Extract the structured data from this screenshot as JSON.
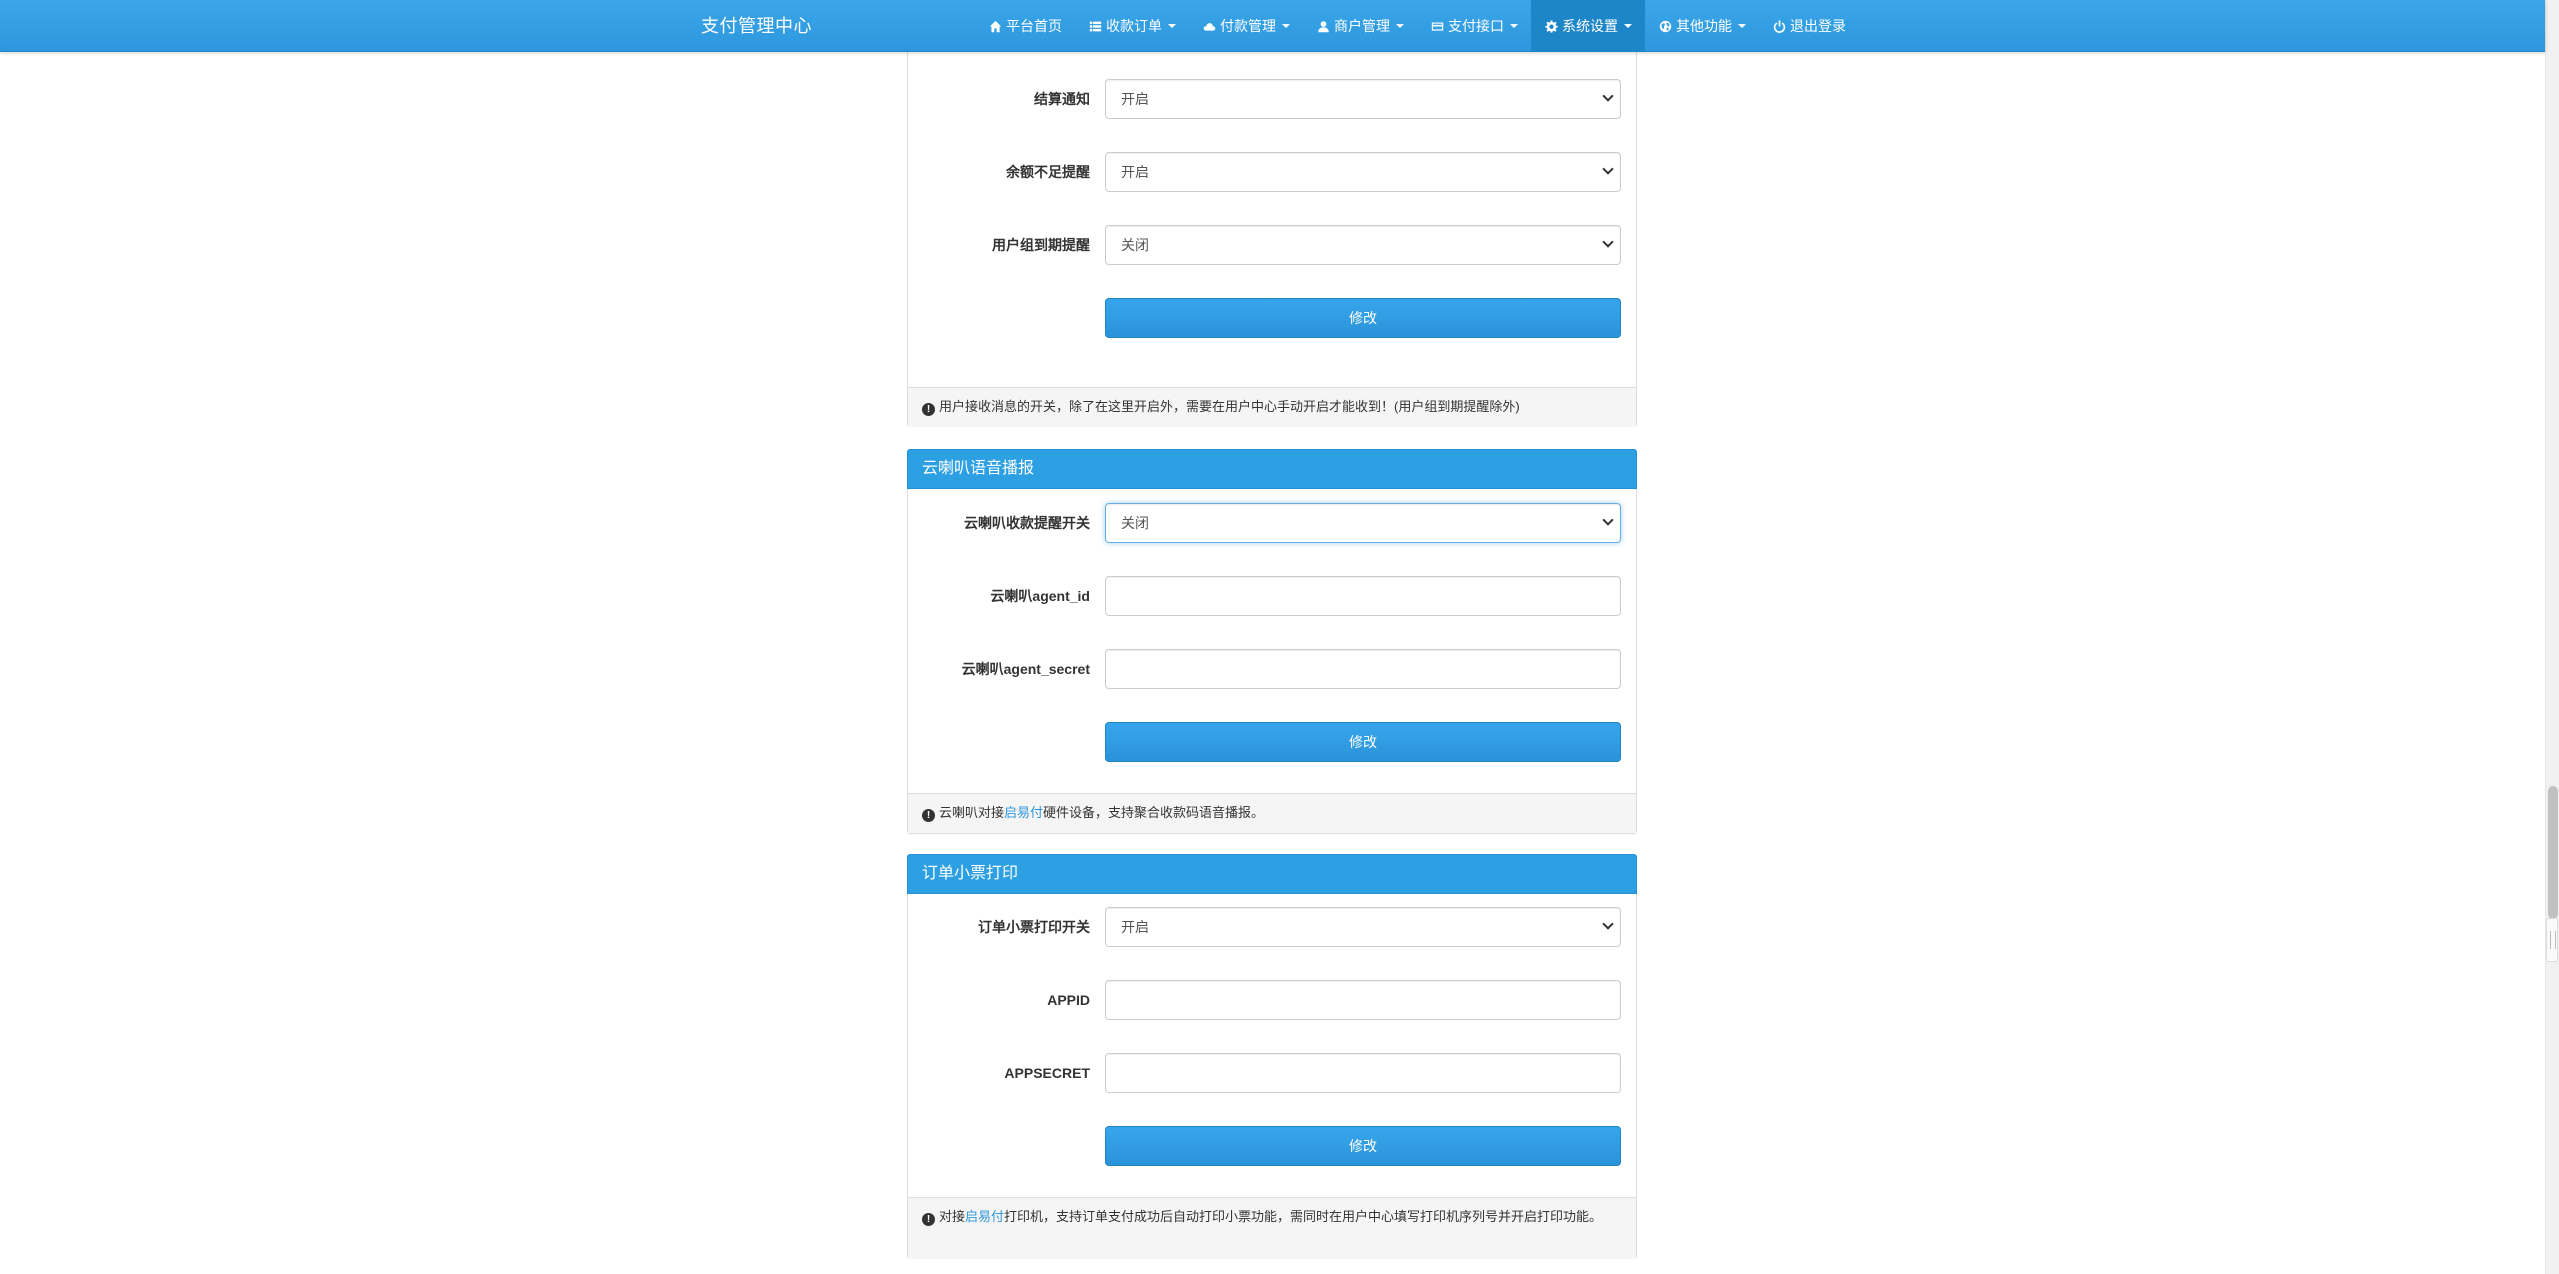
{
  "navbar": {
    "brand": "支付管理中心",
    "items": [
      {
        "label": "平台首页",
        "icon": "home-icon",
        "has_caret": false
      },
      {
        "label": "收款订单",
        "icon": "list-icon",
        "has_caret": true
      },
      {
        "label": "付款管理",
        "icon": "cloud-icon",
        "has_caret": true
      },
      {
        "label": "商户管理",
        "icon": "user-icon",
        "has_caret": true
      },
      {
        "label": "支付接口",
        "icon": "credit-card-icon",
        "has_caret": true
      },
      {
        "label": "系统设置",
        "icon": "gear-icon",
        "has_caret": true,
        "active": true
      },
      {
        "label": "其他功能",
        "icon": "globe-icon",
        "has_caret": true
      },
      {
        "label": "退出登录",
        "icon": "power-icon",
        "has_caret": false
      }
    ]
  },
  "notify_panel": {
    "fields": [
      {
        "label": "结算通知",
        "value": "开启"
      },
      {
        "label": "余额不足提醒",
        "value": "开启"
      },
      {
        "label": "用户组到期提醒",
        "value": "关闭"
      }
    ],
    "submit_label": "修改",
    "footer_text": "用户接收消息的开关，除了在这里开启外，需要在用户中心手动开启才能收到！(用户组到期提醒除外)"
  },
  "speaker_panel": {
    "title": "云喇叭语音播报",
    "switch_label": "云喇叭收款提醒开关",
    "switch_value": "关闭",
    "agent_id_label": "云喇叭agent_id",
    "agent_id_value": "",
    "agent_secret_label": "云喇叭agent_secret",
    "agent_secret_value": "",
    "submit_label": "修改",
    "footer_prefix": "云喇叭对接",
    "footer_link": "启易付",
    "footer_suffix": "硬件设备，支持聚合收款码语音播报。"
  },
  "print_panel": {
    "title": "订单小票打印",
    "switch_label": "订单小票打印开关",
    "switch_value": "开启",
    "appid_label": "APPID",
    "appid_value": "",
    "appsecret_label": "APPSECRET",
    "appsecret_value": "",
    "submit_label": "修改",
    "footer_prefix": "对接",
    "footer_link": "启易付",
    "footer_suffix": "打印机，支持订单支付成功后自动打印小票功能，需同时在用户中心填写打印机序列号并开启打印功能。"
  },
  "colors": {
    "navbar": "#2d9fe3",
    "nav_active": "#1d86c9",
    "panel_heading": "#2d9fe3",
    "button": "#2d97dd",
    "link": "#2d97dd"
  }
}
